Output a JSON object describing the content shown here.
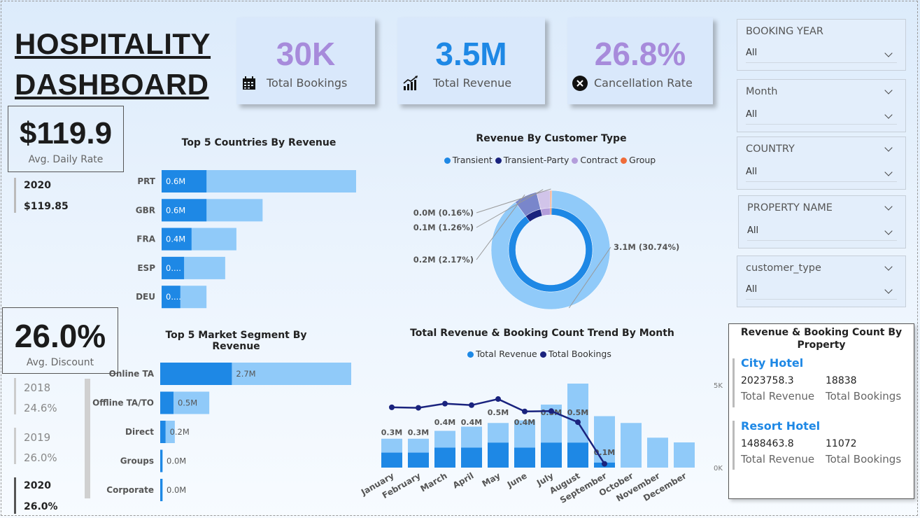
{
  "dashboard": {
    "title_line1": "HOSPITALITY ",
    "title_line2": "DASHBOARD"
  },
  "kpis": [
    {
      "value": "30K",
      "label": "Total Bookings",
      "icon": "calendar-icon",
      "color": "#a78bdb"
    },
    {
      "value": "3.5M",
      "label": "Total Revenue",
      "icon": "bar-chart-icon",
      "color": "#1e88e5"
    },
    {
      "value": "26.8%",
      "label": "Cancellation Rate",
      "icon": "close-circle-icon",
      "color": "#a78bdb"
    }
  ],
  "avg_daily_rate": {
    "value": "$119.9",
    "label": "Avg. Daily Rate",
    "year": "2020",
    "year_value": "$119.85"
  },
  "avg_discount": {
    "value": "26.0%",
    "label": "Avg. Discount",
    "years": [
      {
        "year": "2018",
        "value": "24.6%"
      },
      {
        "year": "2019",
        "value": "26.0%"
      },
      {
        "year": "2020",
        "value": "26.0%"
      }
    ]
  },
  "slicers": [
    {
      "title": "BOOKING YEAR",
      "value": "All"
    },
    {
      "title": "Month",
      "value": "All"
    },
    {
      "title": "COUNTRY",
      "value": "All"
    },
    {
      "title": "PROPERTY NAME",
      "value": "All"
    },
    {
      "title": "customer_type",
      "value": "All"
    }
  ],
  "chart_data": [
    {
      "type": "bar",
      "title": "Top 5 Countries By Revenue",
      "categories": [
        "PRT",
        "GBR",
        "FRA",
        "ESP",
        "DEU"
      ],
      "values": [
        0.6,
        0.6,
        0.4,
        0.3,
        0.25
      ],
      "value_labels": [
        "0.6M",
        "0.6M",
        "0.4M",
        "0....",
        "0...."
      ],
      "background_values": [
        2.6,
        1.35,
        1.0,
        0.85,
        0.6
      ],
      "colors": {
        "value": "#1e88e5",
        "background": "#90caf9"
      }
    },
    {
      "type": "pie",
      "title": "Revenue By Customer Type",
      "legend": [
        "Transient",
        "Transient-Party",
        "Contract",
        "Group"
      ],
      "legend_colors": [
        "#1e88e5",
        "#1a237e",
        "#b39ddb",
        "#ef6c3a"
      ],
      "labels": [
        "3.1M (30.74%)",
        "0.2M (2.17%)",
        "0.1M (1.26%)",
        "0.0M (0.16%)"
      ],
      "values": [
        30.74,
        2.17,
        1.26,
        0.16
      ]
    },
    {
      "type": "bar",
      "title": "Top 5 Market Segment By Revenue",
      "categories": [
        "Online TA",
        "Offline TA/TO",
        "Direct",
        "Groups",
        "Corporate"
      ],
      "values": [
        2.7,
        0.5,
        0.2,
        0.0,
        0.0
      ],
      "value_labels": [
        "2.7M",
        "0.5M",
        "0.2M",
        "0.0M",
        "0.0M"
      ],
      "background_values": [
        7.2,
        1.85,
        0.55,
        0.1,
        0.1
      ]
    },
    {
      "type": "bar",
      "title": "Total Revenue & Booking Count Trend By Month",
      "legend": [
        "Total Revenue",
        "Total Bookings"
      ],
      "categories": [
        "January",
        "February",
        "March",
        "April",
        "May",
        "June",
        "July",
        "August",
        "September",
        "October",
        "November",
        "December"
      ],
      "revenue": [
        0.3,
        0.3,
        0.4,
        0.4,
        0.5,
        0.4,
        0.5,
        0.5,
        0.1,
        0,
        0,
        0
      ],
      "revenue_labels": [
        "0.3M",
        "0.3M",
        "0.4M",
        "0.4M",
        "0.5M",
        "0.4M",
        "0.5M",
        "0.5M",
        "0.1M",
        "",
        "",
        ""
      ],
      "revenue_background": [
        0.55,
        0.55,
        0.7,
        0.78,
        0.85,
        0.9,
        1.2,
        1.6,
        0.98,
        0.85,
        0.57,
        0.48
      ],
      "bookings": [
        3650,
        3620,
        3870,
        3780,
        4150,
        3400,
        3420,
        2750,
        230,
        null,
        null,
        null
      ],
      "y2_ticks": [
        "5K",
        "0K"
      ],
      "y2lim": [
        0,
        5000
      ]
    }
  ],
  "property": {
    "title": "Revenue & Booking Count By Property",
    "items": [
      {
        "name": "City Hotel",
        "revenue": "2023758.3",
        "bookings": "18838",
        "revenue_label": "Total Revenue",
        "bookings_label": "Total Bookings"
      },
      {
        "name": "Resort Hotel",
        "revenue": "1488463.8",
        "bookings": "11072",
        "revenue_label": "Total Revenue",
        "bookings_label": "Total Bookings"
      }
    ]
  }
}
